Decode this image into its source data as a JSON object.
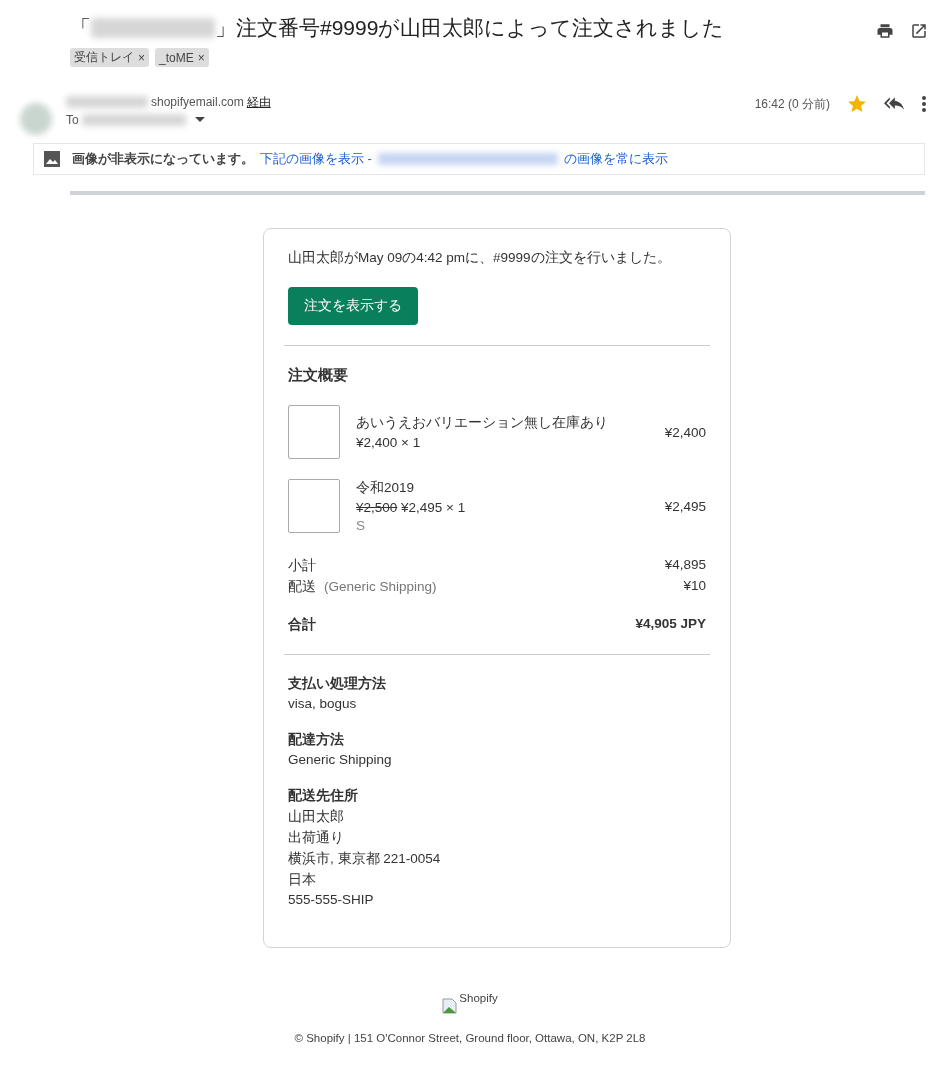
{
  "subject": {
    "prefix": "「",
    "suffix": "」注文番号#9999が山田太郎によって注文されました"
  },
  "labels": [
    {
      "text": "受信トレイ",
      "close": "×"
    },
    {
      "text": "_toME",
      "close": "×"
    }
  ],
  "sender": {
    "domain": "shopifyemail.com",
    "via": "経由",
    "to": "To",
    "time": "16:42 (0 分前)",
    "starred": true
  },
  "notice": {
    "text": "画像が非表示になっています。",
    "show_link": "下記の画像を表示 -",
    "always_link": "の画像を常に表示"
  },
  "order": {
    "intro": "山田太郎がMay 09の4:42 pmに、#9999の注文を行いました。",
    "button": "注文を表示する",
    "summary_title": "注文概要",
    "items": [
      {
        "name": "あいうえおバリエーション無し在庫あり",
        "price": "¥2,400 × 1",
        "total": "¥2,400"
      },
      {
        "name": "令和2019",
        "compare_at": "¥2,500",
        "price": "¥2,495 × 1",
        "variant": "S",
        "total": "¥2,495"
      }
    ],
    "subtotals": [
      {
        "label": "小計",
        "value": "¥4,895"
      },
      {
        "label": "配送",
        "note": "(Generic Shipping)",
        "value": "¥10"
      }
    ],
    "total": {
      "label": "合計",
      "value": "¥4,905 JPY"
    },
    "sections": [
      {
        "title": "支払い処理方法",
        "lines": [
          "visa, bogus"
        ]
      },
      {
        "title": "配達方法",
        "lines": [
          "Generic Shipping"
        ]
      },
      {
        "title": "配送先住所",
        "lines": [
          "山田太郎",
          "出荷通り",
          "横浜市, 東京都 221-0054",
          "日本",
          "555-555-SHIP"
        ]
      }
    ]
  },
  "footer": {
    "logo_alt": "Shopify",
    "address": "© Shopify | 151 O'Connor Street, Ground floor, Ottawa, ON, K2P 2L8"
  }
}
